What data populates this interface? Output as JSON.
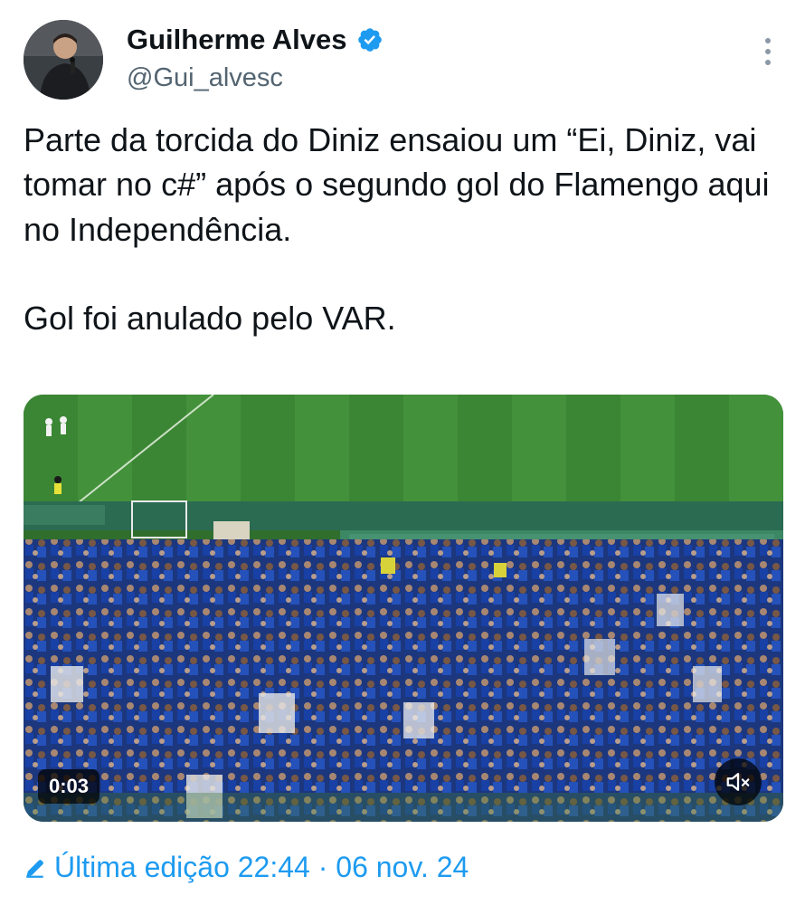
{
  "author": {
    "display_name": "Guilherme Alves",
    "handle": "@Gui_alvesc",
    "verified": true,
    "avatar_icon": "avatar-photo"
  },
  "tweet": {
    "paragraphs": [
      "Parte da torcida do Diniz ensaiou um “Ei, Diniz, vai tomar no c#” após o segundo gol do Flamengo aqui no Independência.",
      "Gol foi anulado pelo VAR."
    ]
  },
  "media": {
    "type": "video",
    "timestamp": "0:03",
    "muted": true,
    "icons": [
      "speaker-muted-icon"
    ]
  },
  "footer": {
    "edit_label": "Última edição 22:44 · 06 nov. 24",
    "icon": "pencil-icon"
  },
  "colors": {
    "accent": "#1d9bf0",
    "secondary_text": "#536471",
    "primary_text": "#0f1419"
  }
}
